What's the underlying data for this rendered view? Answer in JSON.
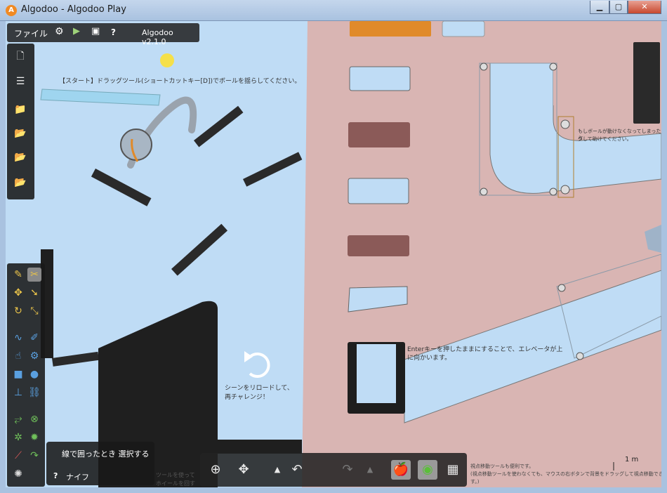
{
  "window": {
    "app_icon_letter": "A",
    "title": "Algodoo - Algodoo Play",
    "minimize": "▁",
    "maximize": "▢",
    "close": "✕"
  },
  "menubar": {
    "file_label": "ファイル",
    "help_label": "?",
    "version": "Algodoo v2.1.0"
  },
  "scene": {
    "start_hint": "【スタート】ドラッグツール(ショートカットキー[D])でボールを揺らしてください。",
    "reload_hint_line1": "シーンをリロードして、",
    "reload_hint_line2": "再チャレンジ！",
    "elevator_hint_line1": "Enterキーを押したままにすることで、エレベータが上",
    "elevator_hint_line2": "に向かいます。",
    "ball_hint_line1": "もしボールが動けなくなってしまったら",
    "ball_hint_line2": "グして助けてください。",
    "scale_label": "1 m",
    "bottom_hint_line1": "ツールを使って",
    "bottom_hint_line2": "ホイールを回す",
    "right_hint_line1": "視点移動ツールも便利です。",
    "right_hint_line2": "(視点移動ツールを使わなくても、マウスの右ボタンで背景をドラッグして視点移動できま",
    "right_hint_line3": "す。)"
  },
  "popup": {
    "option_label": "線で囲ったとき 選択する",
    "help_label": "?",
    "tool_name": "ナイフ"
  },
  "colors": {
    "background": "#bfdcf5",
    "wall": "#d9b5b3",
    "accent_orange": "#e08a2a",
    "bar_dark": "#2a2a2a",
    "brown_slot": "#8b5a58"
  }
}
